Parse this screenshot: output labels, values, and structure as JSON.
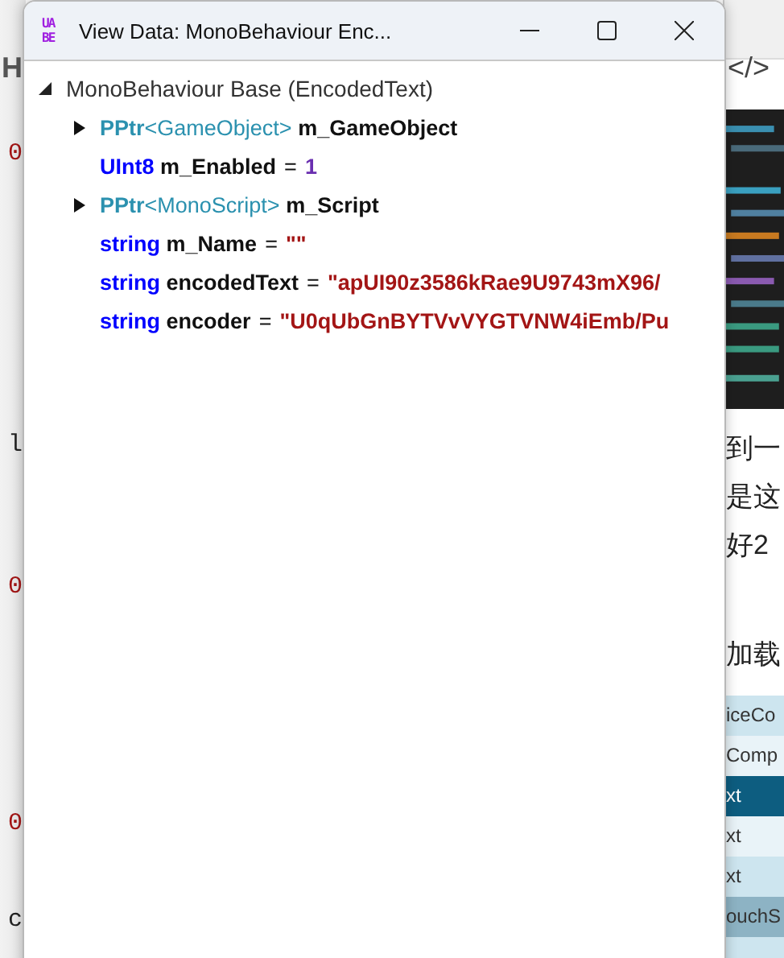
{
  "background_page": {
    "left_fragments": [
      {
        "text": "H",
        "kind": "heading"
      },
      {
        "text": "0",
        "kind": "code-number"
      },
      {
        "text": "l",
        "kind": "code"
      },
      {
        "text": "0",
        "kind": "code-number"
      },
      {
        "text": "0",
        "kind": "code-number"
      },
      {
        "text": "c",
        "kind": "code"
      }
    ],
    "right_toolbar_icon": "</>",
    "right_text_lines": [
      "到一",
      "是这",
      "好2",
      "加载"
    ],
    "right_list_rows": [
      {
        "text": "iceCo",
        "selected": false,
        "hovered": false
      },
      {
        "text": "Comp",
        "selected": false,
        "hovered": false
      },
      {
        "text": "xt",
        "selected": true,
        "hovered": false
      },
      {
        "text": "xt",
        "selected": false,
        "hovered": false
      },
      {
        "text": "xt",
        "selected": false,
        "hovered": false
      },
      {
        "text": "ouchS",
        "selected": false,
        "hovered": true
      },
      {
        "selected": false,
        "hovered": false
      }
    ]
  },
  "window": {
    "icon_letters": [
      "UA",
      "BE"
    ],
    "title": "View Data: MonoBehaviour Enc...",
    "tree": {
      "label": "MonoBehaviour Base (EncodedText)",
      "expanded": true,
      "children": [
        {
          "kind": "pptr",
          "type": "PPtr",
          "type_param": "<GameObject>",
          "name": "m_GameObject",
          "expanded": false
        },
        {
          "kind": "field",
          "type": "UInt8",
          "name": "m_Enabled",
          "equals": "=",
          "number_value": "1"
        },
        {
          "kind": "pptr",
          "type": "PPtr",
          "type_param": "<MonoScript>",
          "name": "m_Script",
          "expanded": false
        },
        {
          "kind": "field",
          "type": "string",
          "name": "m_Name",
          "equals": "=",
          "string_value": "\"\""
        },
        {
          "kind": "field",
          "type": "string",
          "name": "encodedText",
          "equals": "=",
          "string_value": "\"apUI90z3586kRae9U9743mX96/"
        },
        {
          "kind": "field",
          "type": "string",
          "name": "encoder",
          "equals": "=",
          "string_value": "\"U0qUbGnBYTVvVYGTVNW4iEmb/Pu"
        }
      ]
    }
  }
}
